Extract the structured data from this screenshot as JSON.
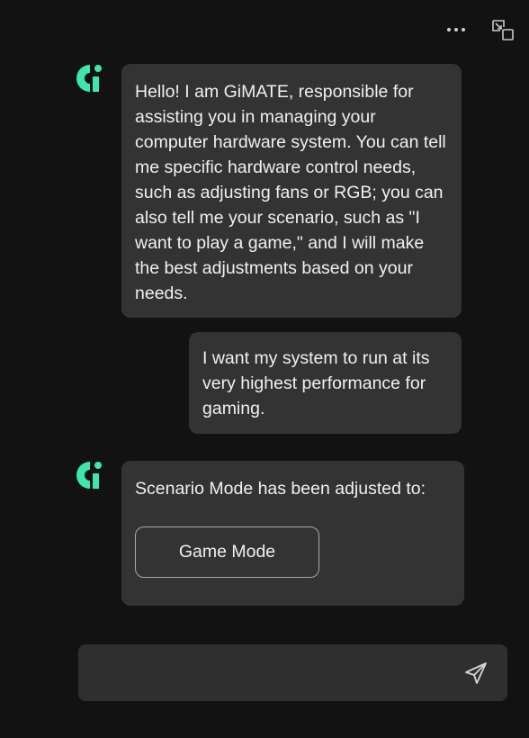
{
  "header": {
    "more_icon": "more-horizontal-icon",
    "popout_icon": "pop-out-window-icon"
  },
  "brand": {
    "avatar_icon": "gimate-logo-icon",
    "accent_color": "#3ee6b0"
  },
  "messages": [
    {
      "role": "assistant",
      "text": "Hello! I am GiMATE, responsible for assisting you in managing your computer hardware system. You can tell me specific hardware control needs, such as adjusting fans or RGB; you can also tell me your scenario, such as \"I want to play a game,\" and I will make the best adjustments based on your needs."
    },
    {
      "role": "user",
      "text": "I want my system to run at its very highest performance for gaming."
    },
    {
      "role": "assistant",
      "text": "Scenario Mode has been adjusted to:",
      "action_label": "Game Mode"
    }
  ],
  "composer": {
    "value": "",
    "placeholder": "",
    "send_icon": "send-icon"
  }
}
